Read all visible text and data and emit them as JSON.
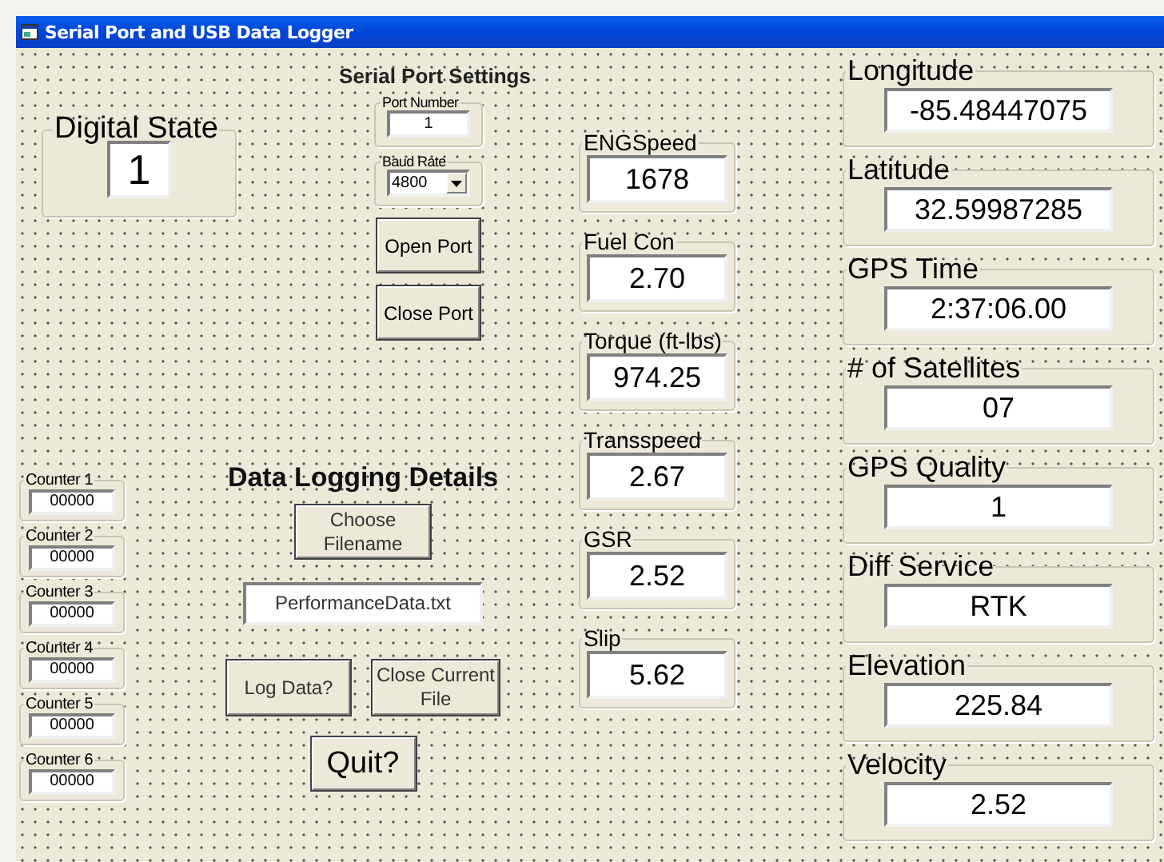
{
  "window": {
    "title": "Serial Port and USB Data Logger"
  },
  "digital_state": {
    "label": "Digital State",
    "value": "1"
  },
  "serial_port_settings": {
    "heading": "Serial Port Settings",
    "port_number": {
      "label": "Port Number",
      "value": "1"
    },
    "baud_rate": {
      "label": "Baud Rate",
      "value": "4800"
    },
    "buttons": [
      "Open Port",
      "Close Port"
    ]
  },
  "counters": [
    {
      "label": "Counter 1",
      "value": "00000"
    },
    {
      "label": "Counter 2",
      "value": "00000"
    },
    {
      "label": "Counter 3",
      "value": "00000"
    },
    {
      "label": "Counter 4",
      "value": "00000"
    },
    {
      "label": "Counter 5",
      "value": "00000"
    },
    {
      "label": "Counter 6",
      "value": "00000"
    }
  ],
  "data_logging": {
    "heading": "Data Logging Details",
    "choose_button": "Choose Filename",
    "filename": "PerformanceData.txt",
    "log_button": "Log Data?",
    "close_button": "Close Current File",
    "quit_button": "Quit?"
  },
  "vehicle_readouts": [
    {
      "label": "ENGSpeed",
      "value": "1678"
    },
    {
      "label": "Fuel Con",
      "value": "2.70"
    },
    {
      "label": "Torque (ft-lbs)",
      "value": "974.25"
    },
    {
      "label": "Transspeed",
      "value": "2.67"
    },
    {
      "label": "GSR",
      "value": "2.52"
    },
    {
      "label": "Slip",
      "value": "5.62"
    }
  ],
  "gps_readouts": [
    {
      "label": "Longitude",
      "value": "-85.48447075"
    },
    {
      "label": "Latitude",
      "value": "32.59987285"
    },
    {
      "label": "GPS Time",
      "value": "2:37:06.00"
    },
    {
      "label": "# of Satellites",
      "value": "07"
    },
    {
      "label": "GPS Quality",
      "value": "1"
    },
    {
      "label": "Diff Service",
      "value": "RTK"
    },
    {
      "label": "Elevation",
      "value": "225.84"
    },
    {
      "label": "Velocity",
      "value": "2.52"
    }
  ]
}
